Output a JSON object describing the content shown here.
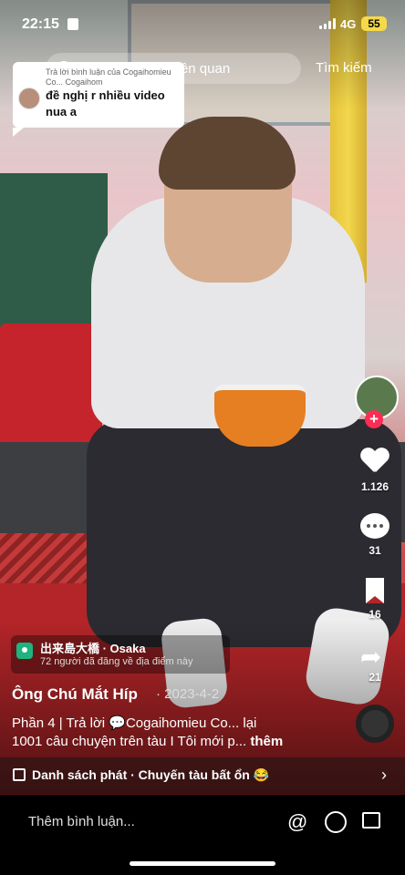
{
  "status_bar": {
    "time": "22:15",
    "network": "4G",
    "battery": "55"
  },
  "search": {
    "placeholder": "Q Tìm nội dung liên quan",
    "action_label": "Tìm kiếm"
  },
  "reply_bubble": {
    "meta": "Trả lời bình luận của Cogaihomieu Co... Cogaihom",
    "text": "đề nghị r nhiều video nua a"
  },
  "actions": {
    "likes": "1.126",
    "comments": "31",
    "saves": "16",
    "shares": "21"
  },
  "location": {
    "name": "出来島大橋 · Osaka",
    "subtitle": "72 người đã đăng về địa điểm này"
  },
  "post": {
    "author": "Ông Chú Mắt Híp",
    "date": "· 2023-4-2",
    "line1": "Phần 4 | Trả lời 💬Cogaihomieu Co...   lại",
    "line2": "1001 câu chuyện trên tàu I Tôi mới p...",
    "more": " thêm"
  },
  "playlist": {
    "label": "Danh sách phát · Chuyến tàu bất ổn 😂"
  },
  "bottom_bar": {
    "comment_placeholder": "Thêm bình luận...",
    "at_symbol": "@"
  }
}
